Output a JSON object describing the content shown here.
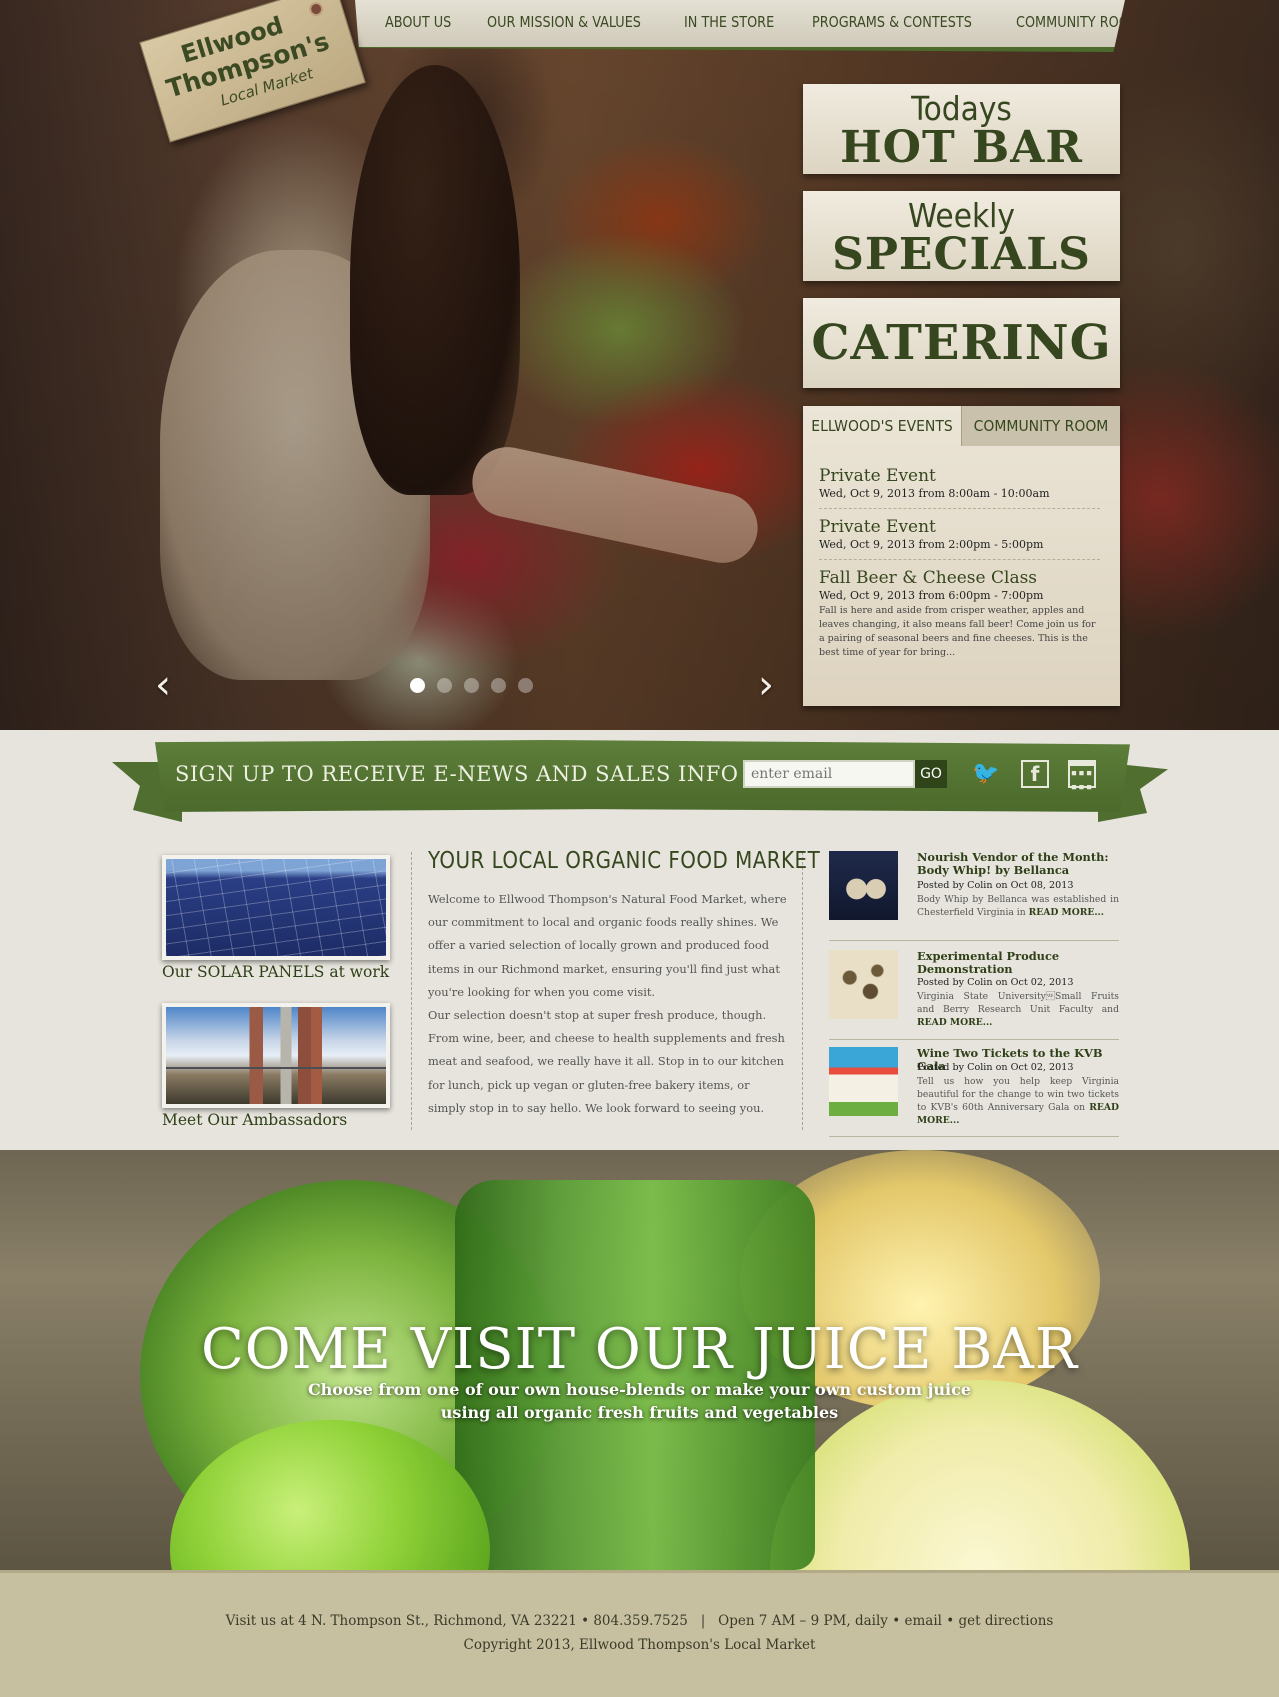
{
  "nav": {
    "items": [
      "ABOUT US",
      "OUR MISSION & VALUES",
      "IN THE STORE",
      "PROGRAMS & CONTESTS",
      "COMMUNITY ROOM"
    ]
  },
  "logo": {
    "line1": "Ellwood",
    "line2": "Thompson's",
    "line3": "Local Market"
  },
  "promos": {
    "hot_bar": {
      "small": "Todays",
      "big": "HOT BAR"
    },
    "specials": {
      "small": "Weekly",
      "big": "SPECIALS"
    },
    "catering": {
      "big": "CATERING"
    }
  },
  "events": {
    "tabs": [
      "ELLWOOD'S EVENTS",
      "COMMUNITY ROOM"
    ],
    "items": [
      {
        "title": "Private Event",
        "date": "Wed, Oct 9, 2013 from 8:00am - 10:00am",
        "desc": ""
      },
      {
        "title": "Private Event",
        "date": "Wed, Oct 9, 2013 from 2:00pm - 5:00pm",
        "desc": ""
      },
      {
        "title": "Fall Beer & Cheese Class",
        "date": "Wed, Oct 9, 2013 from 6:00pm - 7:00pm",
        "desc": "Fall is here and aside from crisper weather, apples and leaves changing, it also means fall beer! Come join us for a pairing of seasonal beers and fine cheeses. This is the best time of year for bring..."
      }
    ]
  },
  "slider": {
    "prev": "‹",
    "next": "›",
    "slide_count": 5,
    "active_slide": 1
  },
  "signup": {
    "text": "SIGN UP TO RECEIVE E-NEWS AND SALES INFO »",
    "placeholder": "enter email",
    "go_label": "GO"
  },
  "icons": {
    "twitter": "twitter-icon",
    "facebook": "facebook-icon",
    "calendar": "calendar-icon"
  },
  "features": {
    "solar_caption": "Our SOLAR PANELS at work",
    "ambassadors_caption": "Meet Our Ambassadors"
  },
  "main": {
    "title": "YOUR LOCAL ORGANIC FOOD MARKET",
    "body": "Welcome to Ellwood Thompson's Natural Food Market, where our commitment to local and organic foods really shines. We offer a varied selection of locally grown and produced food items in our Richmond market, ensuring you'll find just what you're looking for when you come visit.\nOur selection doesn't stop at super fresh produce, though. From wine, beer, and cheese to health supplements and fresh meat and seafood, we really have it all. Stop in to our kitchen for lunch, pick up vegan or gluten-free bakery items, or simply stop in to say hello. We look forward to seeing you."
  },
  "news": [
    {
      "title": "Nourish Vendor of the Month: Body Whip! by Bellanca",
      "meta": "Posted by Colin on Oct 08, 2013",
      "desc": "Body Whip by Bellanca was established in Chesterfield Virginia in",
      "more": "READ MORE..."
    },
    {
      "title": "Experimental Produce Demonstration",
      "meta": "Posted by Colin on Oct 02, 2013",
      "desc": "Virginia State University\u001fSmall Fruits and Berry Research Unit Faculty and",
      "more": "READ MORE..."
    },
    {
      "title": "Wine Two Tickets to the KVB Gala",
      "meta": "Posted by Colin on Oct 02, 2013",
      "desc": "Tell us how you help keep Virginia beautiful for the change to win two tickets to KVB's 60th Anniversary Gala on",
      "more": "READ MORE..."
    }
  ],
  "juice": {
    "title": "COME VISIT OUR JUICE BAR",
    "sub1": "Choose from one of our own house-blends or make your own custom juice",
    "sub2": "using all organic fresh fruits and vegetables"
  },
  "footer": {
    "address": "Visit us at 4 N. Thompson St., Richmond, VA 23221 • 804.359.7525",
    "sep": "|",
    "hours": "Open 7 AM – 9 PM, daily",
    "bullet": "•",
    "email_link": "email",
    "directions_link": "get directions",
    "copyright": "Copyright 2013, Ellwood Thompson's Local Market"
  },
  "colors": {
    "brand_green": "#4b6a2c",
    "dark_green": "#36461e",
    "paper": "#ebe5d7",
    "footer": "#c7c0a0"
  }
}
